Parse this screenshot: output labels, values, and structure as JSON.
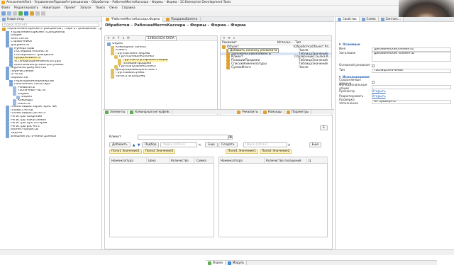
{
  "window": {
    "title": "AmusementPark - УправлениеПарковАттракционов – Обработки – РабочееМестоКассира – Формы – Форма - 1С:Enterprise Development Tools"
  },
  "menu": [
    "Файл",
    "Редактировать",
    "Навигация",
    "Проект",
    "Запуск",
    "Поиск",
    "Окно",
    "Справка"
  ],
  "navigator": {
    "header": "Навигатор",
    "search_placeholder": "Поиск (Ctrl+F)",
    "items": [
      {
        "label": "УправлениеПаркомАттракционов [\"Парк аттракционов\" (релизная ...]",
        "level": 0
      },
      {
        "label": "УправлениеПаркомАттракционов",
        "level": 1
      },
      {
        "label": "Общие",
        "level": 1
      },
      {
        "label": "Константы",
        "level": 1
      },
      {
        "label": "Справочники",
        "level": 1
      },
      {
        "label": "Документы",
        "level": 1
      },
      {
        "label": "Нумераторы",
        "level": 2
      },
      {
        "label": "Последовательности",
        "level": 2
      },
      {
        "label": "ПосещениеАттракциона",
        "level": 2
      },
      {
        "label": "ПродажаБилета",
        "level": 2
      },
      {
        "label": "УстановкаЦенНоменклатуры",
        "level": 2
      },
      {
        "label": "ШаблоныБонусныхПрограммы",
        "level": 2
      },
      {
        "label": "Журналы документов",
        "level": 1
      },
      {
        "label": "Перечисления",
        "level": 1
      },
      {
        "label": "Отчеты",
        "level": 1
      },
      {
        "label": "Обработки",
        "level": 1
      },
      {
        "label": "ПереходНаНовыеВерсии",
        "level": 2
      },
      {
        "label": "РабочееМестоКассира",
        "level": 2
      },
      {
        "label": "Реквизиты",
        "level": 3
      },
      {
        "label": "Табличные части",
        "level": 3
      },
      {
        "label": "Формы",
        "level": 3
      },
      {
        "label": "Форма",
        "level": 4
      },
      {
        "label": "Команды",
        "level": 3
      },
      {
        "label": "Макеты",
        "level": 3
      },
      {
        "label": "Планы видов характеристик",
        "level": 1
      },
      {
        "label": "Планы счетов",
        "level": 1
      },
      {
        "label": "Планы видов расчета",
        "level": 1
      },
      {
        "label": "Регистры сведений",
        "level": 1
      },
      {
        "label": "Регистры накопления",
        "level": 1
      },
      {
        "label": "Регистры бухгалтерии",
        "level": 1
      },
      {
        "label": "Регистры расчета",
        "level": 1
      },
      {
        "label": "Бизнес-процессы",
        "level": 1
      },
      {
        "label": "Задачи",
        "level": 1
      },
      {
        "label": "Внешние источники данных",
        "level": 1
      }
    ],
    "selected_index": 9
  },
  "editor": {
    "tabs": [
      "*РабочееМестоКассира.Форма",
      "ПродажаБилета"
    ],
    "active_tab": 0,
    "form_title": "Обработки – РабочееМестоКассира – Формы – Форма – Форма",
    "resolution": "1280x1024 SXGA",
    "elements_tree": [
      {
        "label": "Форма",
        "level": 0
      },
      {
        "label": "Командная панель",
        "level": 1
      },
      {
        "label": "Клиент",
        "level": 1
      },
      {
        "label": "ГруппаКлиентФормы",
        "level": 1
      },
      {
        "label": "ГруппаЛеваяКолонка",
        "level": 2
      },
      {
        "label": "ГруппаПопулярныеПозиции",
        "level": 3
      },
      {
        "label": "ПозицииПродажи",
        "level": 3
      },
      {
        "label": "ГруппаПраваяКолонка",
        "level": 2
      },
      {
        "label": "ДекорацияВыбранКлиент",
        "level": 1
      },
      {
        "label": "ГруппаВыбСуммы",
        "level": 1
      },
      {
        "label": "ЗаписатьПродажу",
        "level": 1
      }
    ],
    "elements_tree_selected": 5,
    "attributes_header": [
      "Реквизит",
      "Использ...",
      "Тип"
    ],
    "attributes_tooltip": "Добавить колонку реквизита",
    "attributes": [
      {
        "name": "Объект",
        "type": "(ОбработкаОбъект.Ра..."
      },
      {
        "name": "ВыпадСпискамы",
        "type": "Число"
      },
      {
        "name": "ДинамическиеЭлементы",
        "type": "ТаблицаЗначений"
      },
      {
        "name": "Клиент",
        "type": "СправочникСсылка.К..."
      },
      {
        "name": "ПозицииПродажи",
        "type": "ТаблицаЗначений"
      },
      {
        "name": "СписокНоменклатуры",
        "type": "ТаблицаЗначений"
      },
      {
        "name": "СуммаИтого",
        "type": "Число"
      }
    ],
    "panel_tabs_left": [
      "Элементы",
      "Командный интерфейс"
    ],
    "panel_tabs_right": [
      "Реквизиты",
      "Команды",
      "Параметры"
    ],
    "preview": {
      "client_label": "Клиент",
      "left_buttons": [
        "Добавить",
        "Подбор"
      ],
      "left_search_placeholder": "Поиск (Ctrl+F)",
      "left_more": "Еще",
      "left_tags": [
        "Поле1 Значение1",
        "Поле2 Значение2"
      ],
      "left_columns": [
        "Номенклатура",
        "Цена",
        "Количество",
        "Сумма"
      ],
      "right_buttons": [
        "Создать"
      ],
      "right_search_placeholder": "Поиск (Ctrl+F)",
      "right_more": "Еще",
      "right_tags": [
        "Поле1 Значение1",
        "Поле2 Значение2"
      ],
      "right_columns": [
        "Номенклатура",
        "Количество посещений",
        "Ц"
      ],
      "right_edge_button": "Е"
    },
    "bottom_tabs": [
      "Форма",
      "Модуль"
    ]
  },
  "properties": {
    "tabs": [
      "Свойства",
      "Схема",
      "Синтакс..."
    ],
    "sections": {
      "main": "Основные",
      "usage": "Использование"
    },
    "fields": [
      {
        "label": "Имя",
        "value": "ДинамическиеЭлементы"
      },
      {
        "label": "Заголовок",
        "value": "Динамические элементы"
      },
      {
        "label": "Основной реквизит",
        "value": ""
      },
      {
        "label": "Тип",
        "value": "ТаблицаЗначений"
      }
    ],
    "usage_fields": [
      {
        "label": "Сохраняемые данные",
        "value": ""
      },
      {
        "label": "Функциональные опции",
        "value": ""
      },
      {
        "label": "Просмотр",
        "value": "Открыть"
      },
      {
        "label": "Редактировать",
        "value": "Открыть"
      },
      {
        "label": "Проверка заполнения",
        "value": "Не проверять"
      }
    ]
  },
  "colors": {
    "accent": "#2a62b3",
    "selection": "#fff3b0",
    "tag": "#fff3c4"
  }
}
